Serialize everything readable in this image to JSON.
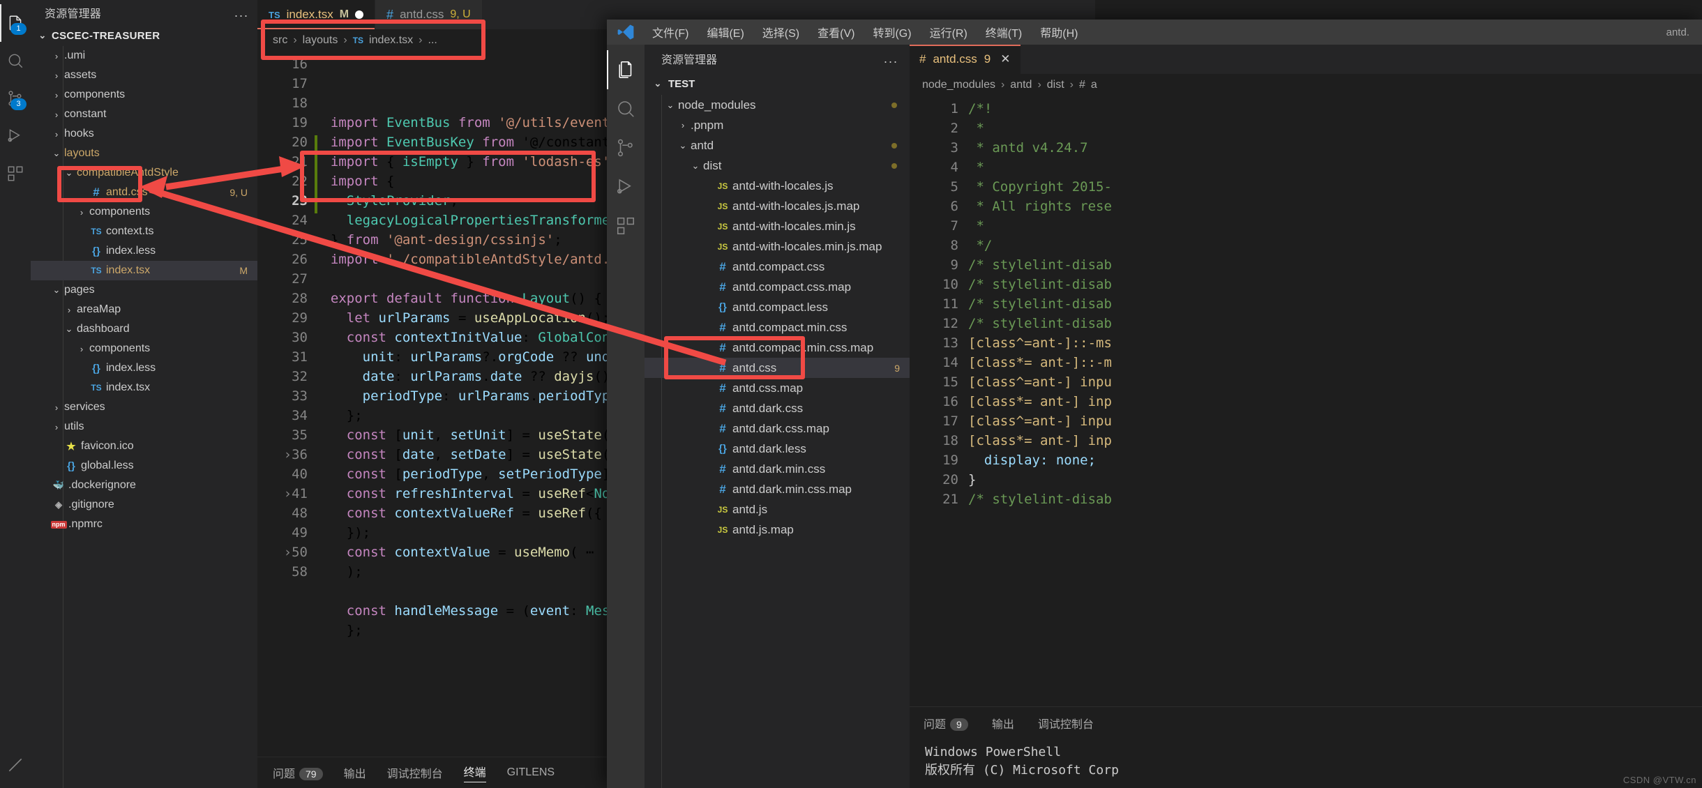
{
  "windowA": {
    "activitybar": {
      "items": [
        {
          "name": "explorer",
          "icon": "files-icon",
          "badge": "1",
          "active": true
        },
        {
          "name": "search",
          "icon": "search-icon",
          "badge": ""
        },
        {
          "name": "source-control",
          "icon": "source-control-icon",
          "badge": "3"
        },
        {
          "name": "run-debug",
          "icon": "run-debug-icon",
          "badge": ""
        },
        {
          "name": "extensions",
          "icon": "extensions-icon",
          "badge": ""
        }
      ]
    },
    "sidebar": {
      "title": "资源管理器",
      "more_label": "...",
      "root": "CSCEC-TREASURER",
      "tree": [
        {
          "label": ".umi",
          "indent": 1,
          "type": "folder",
          "state": "collapsed",
          "clipped": true
        },
        {
          "label": "assets",
          "indent": 1,
          "type": "folder",
          "state": "collapsed"
        },
        {
          "label": "components",
          "indent": 1,
          "type": "folder",
          "state": "collapsed"
        },
        {
          "label": "constant",
          "indent": 1,
          "type": "folder",
          "state": "collapsed"
        },
        {
          "label": "hooks",
          "indent": 1,
          "type": "folder",
          "state": "collapsed"
        },
        {
          "label": "layouts",
          "indent": 1,
          "type": "folder",
          "state": "expanded",
          "modified": true,
          "color": "yellow"
        },
        {
          "label": "compatibleAntdStyle",
          "indent": 2,
          "type": "folder",
          "state": "expanded",
          "modified": true,
          "color": "yellow"
        },
        {
          "label": "antd.css",
          "indent": 3,
          "type": "css",
          "color": "yellow",
          "right": "9, U"
        },
        {
          "label": "components",
          "indent": 3,
          "type": "folder",
          "state": "collapsed"
        },
        {
          "label": "context.ts",
          "indent": 3,
          "type": "ts"
        },
        {
          "label": "index.less",
          "indent": 3,
          "type": "less"
        },
        {
          "label": "index.tsx",
          "indent": 3,
          "type": "ts",
          "selected": true,
          "color": "yellow",
          "right": "M"
        },
        {
          "label": "pages",
          "indent": 1,
          "type": "folder",
          "state": "expanded"
        },
        {
          "label": "areaMap",
          "indent": 2,
          "type": "folder",
          "state": "collapsed"
        },
        {
          "label": "dashboard",
          "indent": 2,
          "type": "folder",
          "state": "expanded"
        },
        {
          "label": "components",
          "indent": 3,
          "type": "folder",
          "state": "collapsed"
        },
        {
          "label": "index.less",
          "indent": 3,
          "type": "less"
        },
        {
          "label": "index.tsx",
          "indent": 3,
          "type": "ts"
        },
        {
          "label": "services",
          "indent": 1,
          "type": "folder",
          "state": "collapsed"
        },
        {
          "label": "utils",
          "indent": 1,
          "type": "folder",
          "state": "collapsed"
        },
        {
          "label": "favicon.ico",
          "indent": 1,
          "type": "ico"
        },
        {
          "label": "global.less",
          "indent": 1,
          "type": "less"
        },
        {
          "label": ".dockerignore",
          "indent": 0,
          "type": "docker"
        },
        {
          "label": ".gitignore",
          "indent": 0,
          "type": "git"
        },
        {
          "label": ".npmrc",
          "indent": 0,
          "type": "npm"
        }
      ]
    },
    "tabs": [
      {
        "label": "index.tsx",
        "icon": "ts-icon",
        "badge": "M",
        "dirty": true,
        "active": true
      },
      {
        "label": "antd.css",
        "icon": "css-icon",
        "count": "9, U",
        "active": false
      }
    ],
    "breadcrumb": [
      "src",
      "layouts",
      "index.tsx",
      "..."
    ],
    "breadcrumb_file_icon": "ts-icon",
    "code_lines": [
      {
        "n": "16",
        "text": "import EventBus from '@/utils/eventBus';",
        "clipped": true
      },
      {
        "n": "17",
        "text": "import EventBusKey from '@/constant/eventBus"
      },
      {
        "n": "18",
        "text": "import { isEmpty } from 'lodash-es';"
      },
      {
        "n": "19",
        "text": "import {"
      },
      {
        "n": "20",
        "text": "  StyleProvider,"
      },
      {
        "n": "21",
        "text": "  legacyLogicalPropertiesTransformer,"
      },
      {
        "n": "22",
        "text": "} from '@ant-design/cssinjs';"
      },
      {
        "n": "23",
        "text": "import './compatibleAntdStyle/antd.css'",
        "highlight": true
      },
      {
        "n": "24",
        "text": ""
      },
      {
        "n": "25",
        "text": "export default function Layout() {"
      },
      {
        "n": "26",
        "text": "  let urlParams = useAppLocation();"
      },
      {
        "n": "27",
        "text": "  const contextInitValue: GlobalContext = {"
      },
      {
        "n": "28",
        "text": "    unit: urlParams?.orgCode ?? undefined,"
      },
      {
        "n": "29",
        "text": "    date: urlParams.date ?? dayjs().format('"
      },
      {
        "n": "30",
        "text": "    periodType: urlParams.periodType ?? 'D',"
      },
      {
        "n": "31",
        "text": "  };"
      },
      {
        "n": "32",
        "text": "  const [unit, setUnit] = useState(contextIn"
      },
      {
        "n": "33",
        "text": "  const [date, setDate] = useState(contextIn"
      },
      {
        "n": "34",
        "text": "  const [periodType, setPeriodType] = useSta"
      },
      {
        "n": "35",
        "text": "  const refreshInterval = useRef<NodeJS.Time"
      },
      {
        "n": "36",
        "text": "  const contextValueRef = useRef({ ⋯",
        "fold": true
      },
      {
        "n": "40",
        "text": "  });"
      },
      {
        "n": "41",
        "text": "  const contextValue = useMemo( ⋯",
        "fold": true
      },
      {
        "n": "48",
        "text": "  );"
      },
      {
        "n": "49",
        "text": ""
      },
      {
        "n": "50",
        "text": "  const handleMessage = (event: MessageEvent",
        "fold": true
      },
      {
        "n": "58",
        "text": "  };"
      }
    ],
    "panel_tabs": [
      "问题",
      "输出",
      "调试控制台",
      "终端",
      "GITLENS"
    ],
    "panel_active": "终端",
    "panel_problem_count": "79"
  },
  "windowB": {
    "menu": [
      "文件(F)",
      "编辑(E)",
      "选择(S)",
      "查看(V)",
      "转到(G)",
      "运行(R)",
      "终端(T)",
      "帮助(H)"
    ],
    "title": "antd.",
    "activitybar": {
      "items": [
        {
          "name": "explorer",
          "icon": "files-icon",
          "active": true
        },
        {
          "name": "search",
          "icon": "search-icon"
        },
        {
          "name": "source-control",
          "icon": "source-control-icon"
        },
        {
          "name": "run-debug",
          "icon": "run-debug-icon"
        },
        {
          "name": "extensions",
          "icon": "extensions-icon"
        }
      ]
    },
    "sidebar": {
      "title": "资源管理器",
      "more_label": "...",
      "root": "TEST",
      "tree": [
        {
          "label": "node_modules",
          "indent": 1,
          "type": "folder",
          "state": "expanded",
          "dot": true
        },
        {
          "label": ".pnpm",
          "indent": 2,
          "type": "folder",
          "state": "collapsed"
        },
        {
          "label": "antd",
          "indent": 2,
          "type": "folder",
          "state": "expanded",
          "dot": true
        },
        {
          "label": "dist",
          "indent": 3,
          "type": "folder",
          "state": "expanded",
          "dot": true
        },
        {
          "label": "antd-with-locales.js",
          "indent": 4,
          "type": "js"
        },
        {
          "label": "antd-with-locales.js.map",
          "indent": 4,
          "type": "js"
        },
        {
          "label": "antd-with-locales.min.js",
          "indent": 4,
          "type": "js"
        },
        {
          "label": "antd-with-locales.min.js.map",
          "indent": 4,
          "type": "js"
        },
        {
          "label": "antd.compact.css",
          "indent": 4,
          "type": "css"
        },
        {
          "label": "antd.compact.css.map",
          "indent": 4,
          "type": "css"
        },
        {
          "label": "antd.compact.less",
          "indent": 4,
          "type": "less"
        },
        {
          "label": "antd.compact.min.css",
          "indent": 4,
          "type": "css"
        },
        {
          "label": "antd.compact.min.css.map",
          "indent": 4,
          "type": "css",
          "clipped": true
        },
        {
          "label": "antd.css",
          "indent": 4,
          "type": "css",
          "selected": true,
          "right": "9",
          "highlight": true
        },
        {
          "label": "antd.css.map",
          "indent": 4,
          "type": "css",
          "clipped": true
        },
        {
          "label": "antd.dark.css",
          "indent": 4,
          "type": "css"
        },
        {
          "label": "antd.dark.css.map",
          "indent": 4,
          "type": "css"
        },
        {
          "label": "antd.dark.less",
          "indent": 4,
          "type": "less"
        },
        {
          "label": "antd.dark.min.css",
          "indent": 4,
          "type": "css"
        },
        {
          "label": "antd.dark.min.css.map",
          "indent": 4,
          "type": "css"
        },
        {
          "label": "antd.js",
          "indent": 4,
          "type": "js"
        },
        {
          "label": "antd.js.map",
          "indent": 4,
          "type": "js",
          "clipped": true
        }
      ]
    },
    "tab": {
      "label": "antd.css",
      "icon": "css-icon",
      "count": "9",
      "close": "✕"
    },
    "breadcrumb": [
      "node_modules",
      "antd",
      "dist",
      "a"
    ],
    "code_lines": [
      {
        "n": "1",
        "text": "/*!",
        "type": "comment"
      },
      {
        "n": "2",
        "text": " *",
        "type": "comment"
      },
      {
        "n": "3",
        "text": " * antd v4.24.7",
        "type": "comment"
      },
      {
        "n": "4",
        "text": " *",
        "type": "comment"
      },
      {
        "n": "5",
        "text": " * Copyright 2015-",
        "type": "comment"
      },
      {
        "n": "6",
        "text": " * All rights rese",
        "type": "comment"
      },
      {
        "n": "7",
        "text": " *",
        "type": "comment"
      },
      {
        "n": "8",
        "text": " */",
        "type": "comment"
      },
      {
        "n": "9",
        "text": "/* stylelint-disab",
        "type": "comment"
      },
      {
        "n": "10",
        "text": "/* stylelint-disab",
        "type": "comment"
      },
      {
        "n": "11",
        "text": "/* stylelint-disab",
        "type": "comment"
      },
      {
        "n": "12",
        "text": "/* stylelint-disab",
        "type": "comment"
      },
      {
        "n": "13",
        "text": "[class^=ant-]::-ms",
        "type": "selector"
      },
      {
        "n": "14",
        "text": "[class*= ant-]::-m",
        "type": "selector"
      },
      {
        "n": "15",
        "text": "[class^=ant-] inpu",
        "type": "selector"
      },
      {
        "n": "16",
        "text": "[class*= ant-] inp",
        "type": "selector"
      },
      {
        "n": "17",
        "text": "[class^=ant-] inpu",
        "type": "selector"
      },
      {
        "n": "18",
        "text": "[class*= ant-] inp",
        "type": "selector"
      },
      {
        "n": "19",
        "text": "  display: none;",
        "type": "prop"
      },
      {
        "n": "20",
        "text": "}",
        "type": "plain"
      },
      {
        "n": "21",
        "text": "/* stylelint-disab",
        "type": "comment"
      }
    ],
    "panel_tabs": [
      "问题",
      "输出",
      "调试控制台"
    ],
    "panel_problem_count": "9",
    "terminal_lines": [
      "Windows PowerShell",
      "版权所有 (C) Microsoft Corp"
    ]
  },
  "watermark": "CSDN @VTW.cn"
}
